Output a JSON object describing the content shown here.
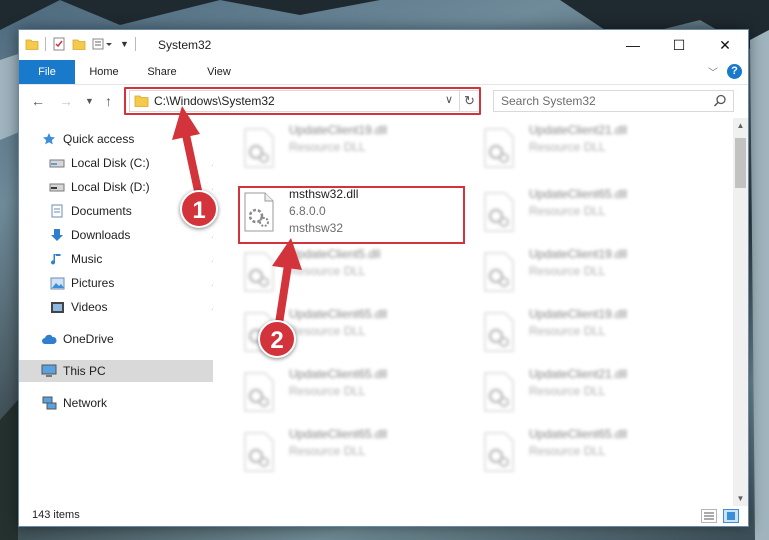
{
  "window": {
    "title": "System32",
    "controls": {
      "minimize": "—",
      "maximize": "☐",
      "close": "✕"
    }
  },
  "ribbon": {
    "tabs": [
      {
        "label": "File"
      },
      {
        "label": "Home"
      },
      {
        "label": "Share"
      },
      {
        "label": "View"
      }
    ],
    "help": "?"
  },
  "navigation": {
    "address_path": "C:\\Windows\\System32",
    "search_placeholder": "Search System32"
  },
  "sidebar": {
    "quick_access": "Quick access",
    "items": [
      {
        "label": "Local Disk (C:)",
        "icon": "drive-icon",
        "pinned": true
      },
      {
        "label": "Local Disk (D:)",
        "icon": "drive-icon",
        "pinned": true
      },
      {
        "label": "Documents",
        "icon": "documents-icon",
        "pinned": true
      },
      {
        "label": "Downloads",
        "icon": "downloads-icon",
        "pinned": true
      },
      {
        "label": "Music",
        "icon": "music-icon",
        "pinned": true
      },
      {
        "label": "Pictures",
        "icon": "pictures-icon",
        "pinned": true
      },
      {
        "label": "Videos",
        "icon": "videos-icon",
        "pinned": true
      }
    ],
    "onedrive": "OneDrive",
    "this_pc": "This PC",
    "network": "Network"
  },
  "files": {
    "highlighted": {
      "name": "msthsw32.dll",
      "version": "6.8.0.0",
      "description": "msthsw32"
    },
    "blurred": [
      {
        "name": "UpdateClient19.dll",
        "type": "Resource DLL"
      },
      {
        "name": "UpdateClient21.dll",
        "type": "Resource DLL"
      },
      {
        "name": "UpdateClient65.dll",
        "type": "Resource DLL"
      },
      {
        "name": "UpdateClient5.dll",
        "type": "Resource DLL"
      },
      {
        "name": "UpdateClient19.dll",
        "type": "Resource DLL"
      },
      {
        "name": "UpdateClient65.dll",
        "type": "Resource DLL"
      },
      {
        "name": "UpdateClient19.dll",
        "type": "Resource DLL"
      },
      {
        "name": "UpdateClient65.dll",
        "type": "Resource DLL"
      },
      {
        "name": "UpdateClient21.dll",
        "type": "Resource DLL"
      },
      {
        "name": "UpdateClient65.dll",
        "type": "Resource DLL"
      },
      {
        "name": "UpdateClient65.dll",
        "type": "Resource DLL"
      }
    ]
  },
  "status": {
    "item_count": "143 items"
  },
  "annotations": {
    "step1": "1",
    "step2": "2",
    "color": "#d3333a"
  }
}
